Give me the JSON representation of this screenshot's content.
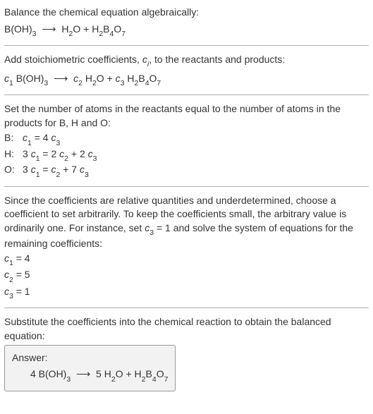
{
  "step1": {
    "prompt": "Balance the chemical equation algebraically:",
    "r1": "B(OH)",
    "r1_sub": "3",
    "arrow": "⟶",
    "p1a": "H",
    "p1a_sub": "2",
    "p1b": "O + H",
    "p1b_sub": "2",
    "p1c": "B",
    "p1c_sub": "4",
    "p1d": "O",
    "p1d_sub": "7"
  },
  "step2": {
    "prompt_a": "Add stoichiometric coefficients, ",
    "ci": "c",
    "ci_sub": "i",
    "prompt_b": ", to the reactants and products:",
    "c1": "c",
    "s1": "1",
    "r1": " B(OH)",
    "r1_sub": "3",
    "arrow": "⟶",
    "c2": "c",
    "s2": "2",
    "p1a": " H",
    "p1a_sub": "2",
    "p1b": "O + ",
    "c3": "c",
    "s3": "3",
    "p2a": " H",
    "p2a_sub": "2",
    "p2b": "B",
    "p2b_sub": "4",
    "p2c": "O",
    "p2c_sub": "7"
  },
  "step3": {
    "prompt": "Set the number of atoms in the reactants equal to the number of atoms in the products for B, H and O:",
    "rows": [
      {
        "label": "B:",
        "c": "c",
        "s": "1",
        "eq": " = 4 ",
        "c2": "c",
        "s2": "3",
        "tail": ""
      },
      {
        "label": "H:",
        "pre": "3 ",
        "c": "c",
        "s": "1",
        "eq": " = 2 ",
        "c2": "c",
        "s2": "2",
        "mid": " + 2 ",
        "c3": "c",
        "s3": "3"
      },
      {
        "label": "O:",
        "pre": "3 ",
        "c": "c",
        "s": "1",
        "eq": " = ",
        "c2": "c",
        "s2": "2",
        "mid": " + 7 ",
        "c3": "c",
        "s3": "3"
      }
    ]
  },
  "step4": {
    "prompt_a": "Since the coefficients are relative quantities and underdetermined, choose a coefficient to set arbitrarily. To keep the coefficients small, the arbitrary value is ordinarily one. For instance, set ",
    "cv": "c",
    "cv_sub": "3",
    "prompt_b": " = 1 and solve the system of equations for the remaining coefficients:",
    "lines": [
      {
        "c": "c",
        "s": "1",
        "v": " = 4"
      },
      {
        "c": "c",
        "s": "2",
        "v": " = 5"
      },
      {
        "c": "c",
        "s": "3",
        "v": " = 1"
      }
    ]
  },
  "step5": {
    "prompt": "Substitute the coefficients into the chemical reaction to obtain the balanced equation:",
    "answer_label": "Answer:",
    "n1": "4 B(OH)",
    "n1_sub": "3",
    "arrow": "⟶",
    "n2": "5 H",
    "n2_sub": "2",
    "n3": "O + H",
    "n3_sub": "2",
    "n4": "B",
    "n4_sub": "4",
    "n5": "O",
    "n5_sub": "7"
  }
}
